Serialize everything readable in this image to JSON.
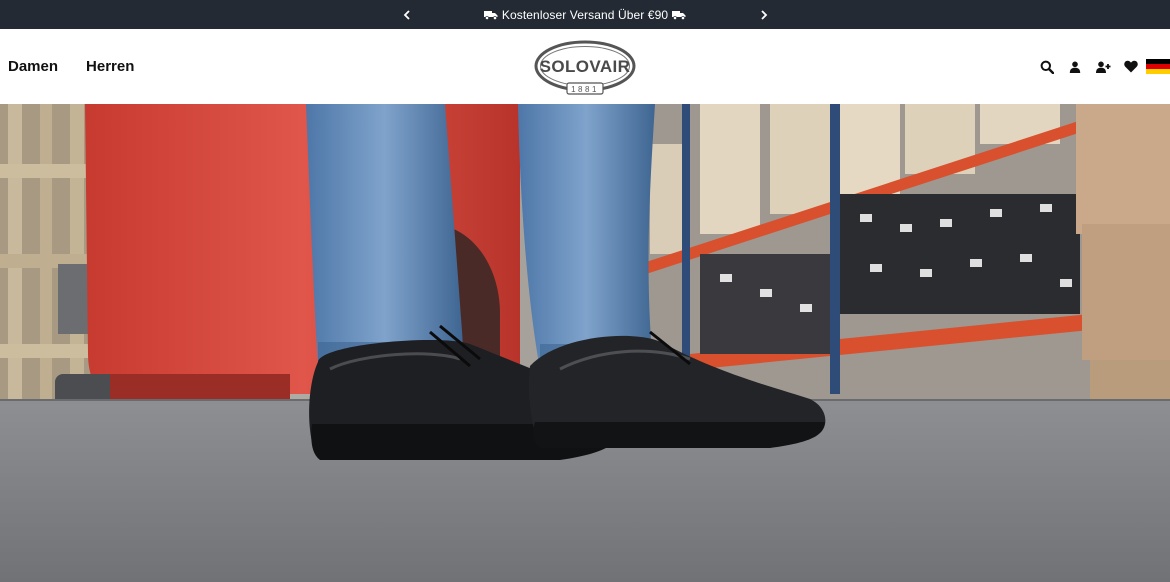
{
  "announcement": {
    "text": "Kostenloser Versand Über €90",
    "prev_icon": "chevron-left-icon",
    "next_icon": "chevron-right-icon",
    "truck_icon": "truck-icon"
  },
  "nav": {
    "items": [
      {
        "label": "Damen"
      },
      {
        "label": "Herren"
      }
    ]
  },
  "logo": {
    "brand": "SOLOVAIR",
    "year": "1881"
  },
  "header_icons": [
    {
      "icon": "search-icon"
    },
    {
      "icon": "user-icon"
    },
    {
      "icon": "add-user-icon"
    },
    {
      "icon": "heart-icon"
    },
    {
      "icon": "flag-germany-icon"
    }
  ],
  "colors": {
    "announcement_bg": "#232a33",
    "text_dark": "#111111",
    "flag_black": "#000000",
    "flag_red": "#dd0000",
    "flag_gold": "#ffce00"
  }
}
